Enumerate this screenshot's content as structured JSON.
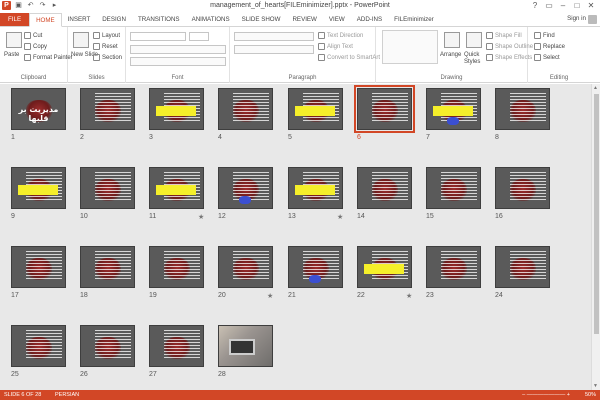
{
  "window": {
    "title": "management_of_hearts[FILEminimizer].pptx - PowerPoint",
    "controls": [
      "?",
      "▭",
      "–",
      "□",
      "✕"
    ]
  },
  "qat": {
    "app_icon": "P",
    "icons": [
      "save-icon",
      "undo-icon",
      "redo-icon",
      "present-icon"
    ]
  },
  "tabs": [
    "FILE",
    "HOME",
    "INSERT",
    "DESIGN",
    "TRANSITIONS",
    "ANIMATIONS",
    "SLIDE SHOW",
    "REVIEW",
    "VIEW",
    "ADD-INS",
    "FILEminimizer"
  ],
  "active_tab": "HOME",
  "signin": "Sign in",
  "ribbon": {
    "clipboard": {
      "label": "Clipboard",
      "paste": "Paste",
      "cut": "Cut",
      "copy": "Copy",
      "format_painter": "Format Painter"
    },
    "slides": {
      "label": "Slides",
      "new_slide": "New Slide",
      "layout": "Layout",
      "reset": "Reset",
      "section": "Section"
    },
    "font": {
      "label": "Font"
    },
    "paragraph": {
      "label": "Paragraph",
      "text_direction": "Text Direction",
      "align_text": "Align Text",
      "convert_smartart": "Convert to SmartArt"
    },
    "drawing": {
      "label": "Drawing",
      "arrange": "Arrange",
      "quick_styles": "Quick Styles",
      "shape_fill": "Shape Fill",
      "shape_outline": "Shape Outline",
      "shape_effects": "Shape Effects"
    },
    "editing": {
      "label": "Editing",
      "find": "Find",
      "replace": "Replace",
      "select": "Select"
    }
  },
  "slides": [
    {
      "n": "1",
      "kind": "title",
      "text": "مدیریت بر قلبها"
    },
    {
      "n": "2",
      "kind": "text"
    },
    {
      "n": "3",
      "kind": "yellow"
    },
    {
      "n": "4",
      "kind": "text"
    },
    {
      "n": "5",
      "kind": "yellow"
    },
    {
      "n": "6",
      "kind": "text",
      "selected": true
    },
    {
      "n": "7",
      "kind": "yellow-blue"
    },
    {
      "n": "8",
      "kind": "text"
    },
    {
      "n": "9",
      "kind": "yellow"
    },
    {
      "n": "10",
      "kind": "text"
    },
    {
      "n": "11",
      "kind": "yellow",
      "star": "★"
    },
    {
      "n": "12",
      "kind": "blue"
    },
    {
      "n": "13",
      "kind": "yellow",
      "star": "★"
    },
    {
      "n": "14",
      "kind": "text"
    },
    {
      "n": "15",
      "kind": "text"
    },
    {
      "n": "16",
      "kind": "text"
    },
    {
      "n": "17",
      "kind": "text"
    },
    {
      "n": "18",
      "kind": "text"
    },
    {
      "n": "19",
      "kind": "text"
    },
    {
      "n": "20",
      "kind": "text",
      "star": "★"
    },
    {
      "n": "21",
      "kind": "blue"
    },
    {
      "n": "22",
      "kind": "yellow",
      "star": "★"
    },
    {
      "n": "23",
      "kind": "text"
    },
    {
      "n": "24",
      "kind": "text"
    },
    {
      "n": "25",
      "kind": "text"
    },
    {
      "n": "26",
      "kind": "text"
    },
    {
      "n": "27",
      "kind": "text"
    },
    {
      "n": "28",
      "kind": "photo"
    }
  ],
  "status": {
    "slide_info": "SLIDE 6 OF 28",
    "language": "PERSIAN",
    "zoom": "50%"
  },
  "colors": {
    "accent": "#d24726",
    "sorter_bg": "#e8e8e8",
    "slide_bg": "#5a5a5a",
    "highlight": "#f5ef2a"
  }
}
